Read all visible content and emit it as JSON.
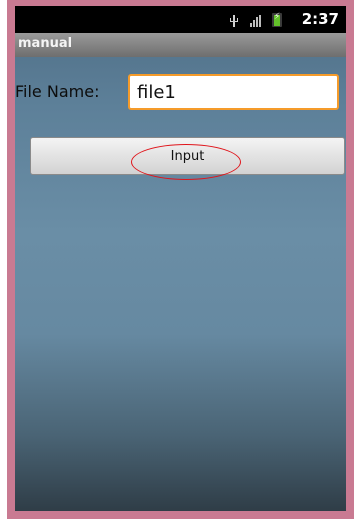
{
  "status_bar": {
    "time": "2:37",
    "icons": [
      "usb-icon",
      "signal-icon",
      "battery-charging-icon"
    ],
    "battery_color": "#63c12a"
  },
  "app": {
    "title": "manual"
  },
  "form": {
    "file_name_label": "File Name:",
    "file_name_value": "file1",
    "input_button_label": "Input"
  },
  "annotation": {
    "shape": "ellipse",
    "color": "#e0151b",
    "target": "input-button"
  },
  "colors": {
    "input_focus_border": "#f59b2a",
    "frame": "#c97a92"
  }
}
